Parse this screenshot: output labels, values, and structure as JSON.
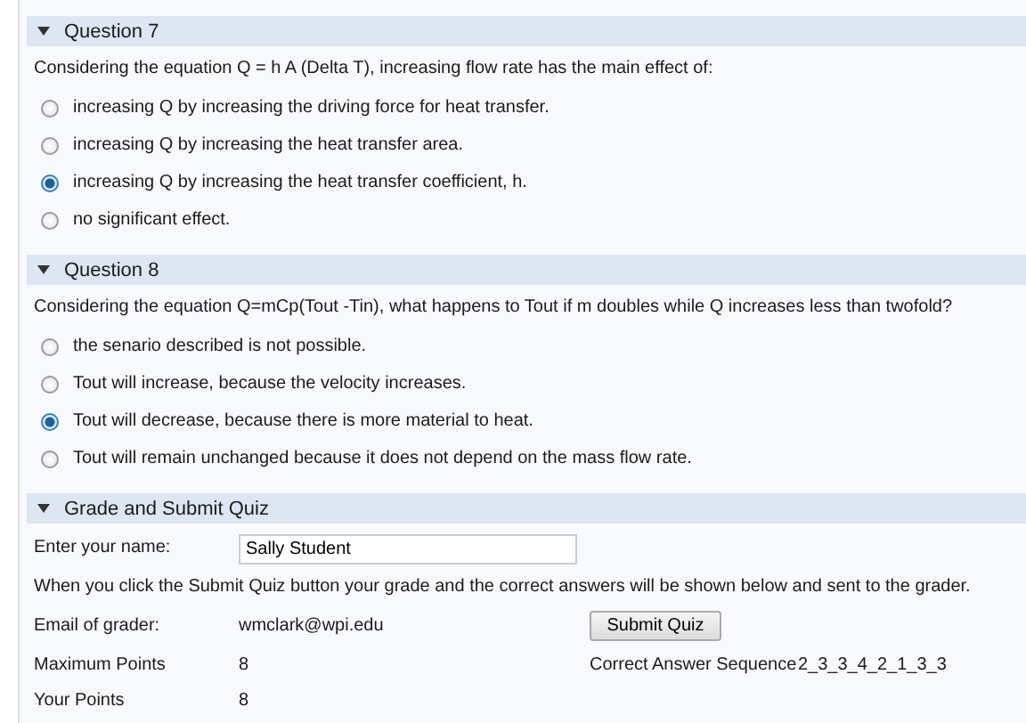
{
  "questions": [
    {
      "title": "Question 7",
      "expanded": true,
      "prompt": "Considering the equation Q = h A (Delta T), increasing flow rate has the main effect of:",
      "options": [
        {
          "label": "increasing Q by increasing the driving force for heat transfer.",
          "selected": false
        },
        {
          "label": "increasing Q by increasing the heat transfer area.",
          "selected": false
        },
        {
          "label": "increasing Q by increasing the heat transfer coefficient, h.",
          "selected": true
        },
        {
          "label": "no significant effect.",
          "selected": false
        }
      ]
    },
    {
      "title": "Question 8",
      "expanded": true,
      "prompt": "Considering the equation Q=mCp(Tout -Tin), what happens to Tout if m doubles while Q increases less than twofold?",
      "options": [
        {
          "label": "the senario described is not possible.",
          "selected": false
        },
        {
          "label": "Tout will increase, because the velocity increases.",
          "selected": false
        },
        {
          "label": "Tout will decrease, because there is more material to heat.",
          "selected": true
        },
        {
          "label": "Tout will remain unchanged because it does not depend on the mass flow rate.",
          "selected": false
        }
      ]
    }
  ],
  "grade": {
    "title": "Grade and Submit Quiz",
    "expanded": true,
    "name_label": "Enter your name:",
    "name_value": "Sally Student",
    "note": "When you click the Submit Quiz button your grade and the correct answers will be shown below and sent to the grader.",
    "email_label": "Email of grader:",
    "email_value": "wmclark@wpi.edu",
    "submit_button": "Submit Quiz",
    "max_label": "Maximum Points",
    "max_value": "8",
    "sequence_label": "Correct Answer Sequence",
    "sequence_value": "2_3_3_4_2_1_3_3",
    "points_label": "Your Points",
    "points_value": "8"
  }
}
